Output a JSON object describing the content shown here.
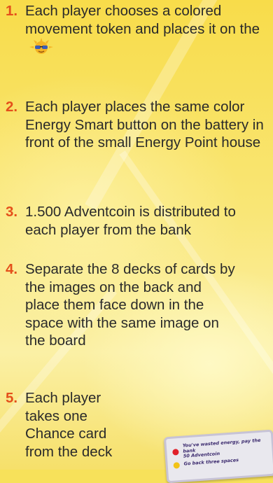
{
  "steps": [
    {
      "number": "1.",
      "text": "Each player chooses a colored movement token and places it on the"
    },
    {
      "number": "2.",
      "text": "Each player places the same color Energy Smart button on the battery in front of the small Energy Point house"
    },
    {
      "number": "3.",
      "text": "1.500 Adventcoin is distributed to each player from the bank"
    },
    {
      "number": "4.",
      "text": "Separate the 8 decks of cards by the images on the back and place them face down in the space with the same image on the board"
    },
    {
      "number": "5.",
      "text": "Each player takes one Chance card from the deck"
    }
  ],
  "chance_card": {
    "line1a": "You've wasted energy, pay the bank",
    "line1b": "50 Adventcoin",
    "line2": "Go back three spaces"
  },
  "colors": {
    "number": "#e4501b",
    "text": "#2a2a2a",
    "background": "#f7e15a",
    "dot_red": "#e0202a",
    "dot_yellow": "#f2c318"
  },
  "icons": {
    "start_space": "sun-with-sunglasses-icon"
  }
}
